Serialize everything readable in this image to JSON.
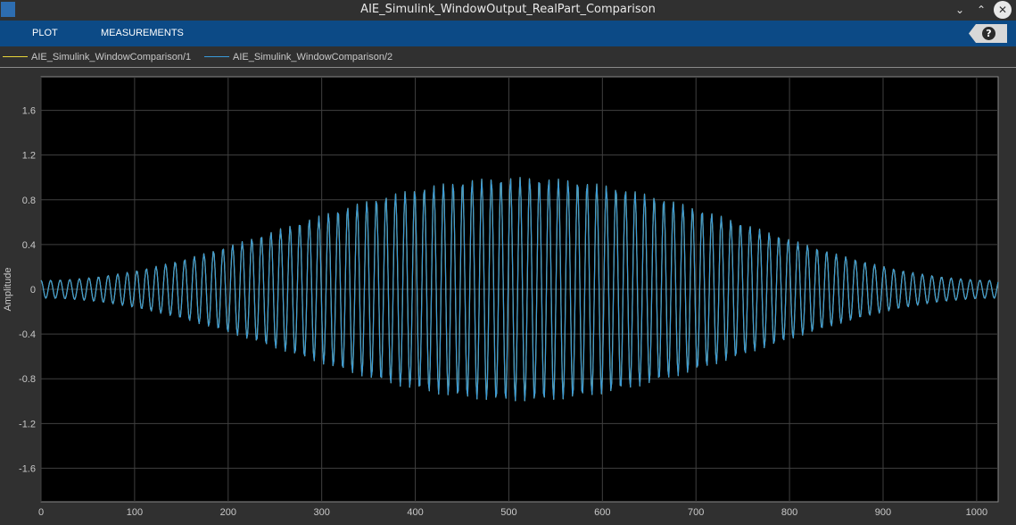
{
  "window": {
    "title": "AIE_Simulink_WindowOutput_RealPart_Comparison"
  },
  "toolstrip": {
    "tabs": [
      "PLOT",
      "MEASUREMENTS"
    ],
    "help_label": "?"
  },
  "legend": {
    "items": [
      {
        "label": "AIE_Simulink_WindowComparison/1",
        "color": "#e8d53a"
      },
      {
        "label": "AIE_Simulink_WindowComparison/2",
        "color": "#3a9ad9"
      }
    ]
  },
  "colors": {
    "background": "#303030",
    "plot_bg": "#000000",
    "grid": "#404040",
    "toolstrip": "#0c4a86",
    "signal": "#3a9ad9"
  },
  "chart_data": {
    "type": "line",
    "ylabel": "Amplitude",
    "xlabel": "",
    "xlim": [
      0,
      1023
    ],
    "ylim": [
      -1.9,
      1.9
    ],
    "xticks": [
      0,
      100,
      200,
      300,
      400,
      500,
      600,
      700,
      800,
      900,
      1000
    ],
    "xtick_labels": [
      "0",
      "100",
      "200",
      "300",
      "400",
      "500",
      "600",
      "700",
      "800",
      "900",
      "1000"
    ],
    "yticks": [
      1.6,
      1.2,
      0.8,
      0.4,
      0,
      -0.4,
      -0.8,
      -1.2,
      -1.6
    ],
    "ytick_labels": [
      "1.6",
      "1.2",
      "0.8",
      "0.4",
      "0",
      "-0.4",
      "-0.8",
      "-1.2",
      "-1.6"
    ],
    "grid": true,
    "legend_position": "top-left",
    "series": [
      {
        "name": "AIE_Simulink_WindowComparison/1",
        "color": "#e8d53a",
        "envelope": "hann",
        "samples": 1024,
        "cycles": 100,
        "peak_amplitude": 1.0
      },
      {
        "name": "AIE_Simulink_WindowComparison/2",
        "color": "#3a9ad9",
        "envelope": "hann",
        "samples": 1024,
        "cycles": 100,
        "peak_amplitude": 1.0
      }
    ]
  }
}
